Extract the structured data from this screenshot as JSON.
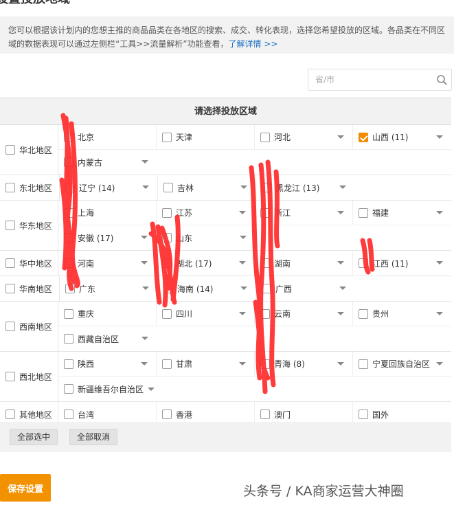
{
  "title": "设置投放地域",
  "info": {
    "text": "您可以根据该计划内的您想主推的商品品类在各地区的搜索、成交、转化表现，选择您希望投放的区域。各品类在不同区域的数据表现可以通过左侧栏“工具>>流量解析”功能查看，",
    "link": "了解详情 >>"
  },
  "search": {
    "placeholder": "省/市"
  },
  "grid_title": "请选择投放区域",
  "regions": [
    {
      "label": "华北地区",
      "rows": [
        [
          {
            "name": "北京",
            "dropdown": false
          },
          {
            "name": "天津",
            "dropdown": false
          },
          {
            "name": "河北",
            "dropdown": true
          },
          {
            "name": "山西 (11)",
            "dropdown": true,
            "checked": true
          }
        ],
        [
          {
            "name": "内蒙古",
            "dropdown": true
          }
        ]
      ]
    },
    {
      "label": "东北地区",
      "rows": [
        [
          {
            "name": "辽宁 (14)",
            "dropdown": true
          },
          {
            "name": "吉林",
            "dropdown": true
          },
          {
            "name": "黑龙江 (13)",
            "dropdown": true
          }
        ]
      ]
    },
    {
      "label": "华东地区",
      "rows": [
        [
          {
            "name": "上海",
            "dropdown": false
          },
          {
            "name": "江苏",
            "dropdown": true
          },
          {
            "name": "浙江",
            "dropdown": true
          },
          {
            "name": "福建",
            "dropdown": true
          }
        ],
        [
          {
            "name": "安徽 (17)",
            "dropdown": true
          },
          {
            "name": "山东",
            "dropdown": true
          }
        ]
      ]
    },
    {
      "label": "华中地区",
      "rows": [
        [
          {
            "name": "河南",
            "dropdown": true
          },
          {
            "name": "湖北 (17)",
            "dropdown": true
          },
          {
            "name": "湖南",
            "dropdown": true
          },
          {
            "name": "江西 (11)",
            "dropdown": true
          }
        ]
      ]
    },
    {
      "label": "华南地区",
      "rows": [
        [
          {
            "name": "广东",
            "dropdown": true
          },
          {
            "name": "海南 (14)",
            "dropdown": true
          },
          {
            "name": "广西",
            "dropdown": true
          }
        ]
      ]
    },
    {
      "label": "西南地区",
      "rows": [
        [
          {
            "name": "重庆",
            "dropdown": false
          },
          {
            "name": "四川",
            "dropdown": true
          },
          {
            "name": "云南",
            "dropdown": true
          },
          {
            "name": "贵州",
            "dropdown": true
          }
        ],
        [
          {
            "name": "西藏自治区",
            "dropdown": true
          }
        ]
      ]
    },
    {
      "label": "西北地区",
      "rows": [
        [
          {
            "name": "陕西",
            "dropdown": true
          },
          {
            "name": "甘肃",
            "dropdown": true
          },
          {
            "name": "青海 (8)",
            "dropdown": true
          },
          {
            "name": "宁夏回族自治区",
            "dropdown": true
          }
        ],
        [
          {
            "name": "新疆维吾尔自治区",
            "dropdown": true,
            "wide": true
          }
        ]
      ]
    },
    {
      "label": "其他地区",
      "rows": [
        [
          {
            "name": "台湾",
            "dropdown": false
          },
          {
            "name": "香港",
            "dropdown": false
          },
          {
            "name": "澳门",
            "dropdown": false
          },
          {
            "name": "国外",
            "dropdown": false
          }
        ]
      ]
    }
  ],
  "buttons": {
    "select_all": "全部选中",
    "deselect_all": "全部取消",
    "save": "保存设置"
  },
  "watermark": "头条号 / KA商家运营大神圈",
  "colors": {
    "accent": "#f39200",
    "link": "#1a6fc4",
    "scribble": "#ff2a2a"
  }
}
